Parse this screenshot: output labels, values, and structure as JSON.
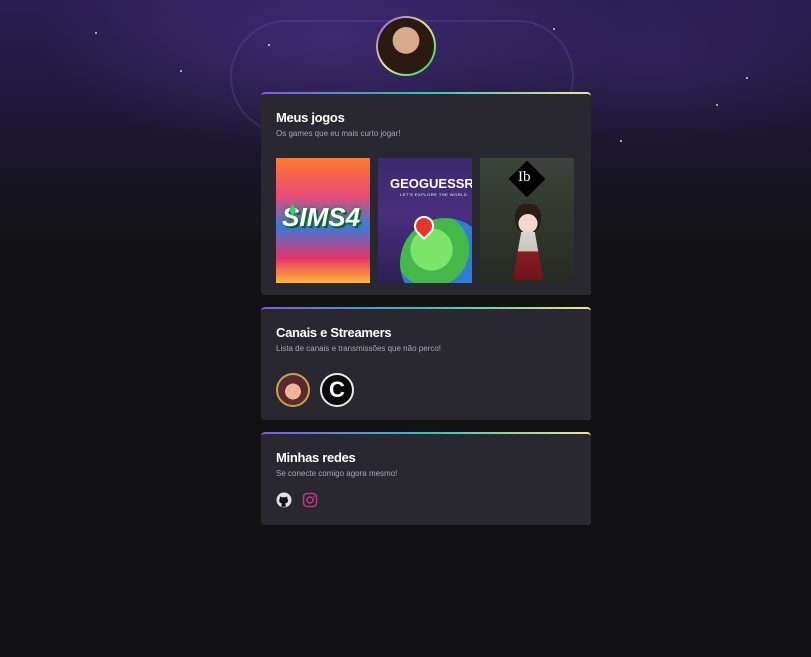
{
  "profile": {
    "avatar_alt": ""
  },
  "games_card": {
    "title": "Meus jogos",
    "subtitle": "Os games que eu mais curto jogar!",
    "games": [
      {
        "name": "The Sims 4",
        "logo_text": "SIMS4"
      },
      {
        "name": "GeoGuessr",
        "logo_text": "GEOGUESSR",
        "tagline": "LET'S EXPLORE THE WORLD"
      },
      {
        "name": "Ib",
        "logo_text": "Ib"
      }
    ]
  },
  "channels_card": {
    "title": "Canais e Streamers",
    "subtitle": "Lista de canais e transmissões que não perco!",
    "channels": [
      {
        "icon": "streamer-avatar"
      },
      {
        "icon": "channel-logo",
        "glyph": "C"
      }
    ]
  },
  "social_card": {
    "title": "Minhas redes",
    "subtitle": "Se conecte comigo agora mesmo!",
    "links": [
      {
        "icon": "github-icon",
        "color": "#e1e1e6"
      },
      {
        "icon": "instagram-icon",
        "color": "#c13584"
      }
    ]
  },
  "colors": {
    "background": "#121214",
    "card": "#29272f",
    "accent_purple": "#8257e5",
    "accent_yellow": "#f0e68c"
  }
}
